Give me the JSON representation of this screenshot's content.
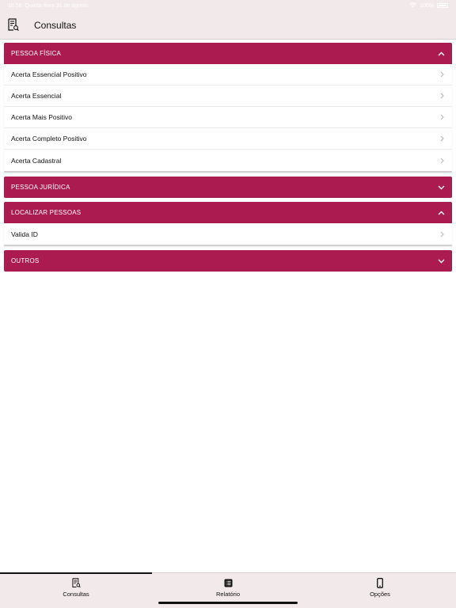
{
  "status_bar": {
    "time": "10:56",
    "date": "Quarta-feira 31 de agosto",
    "battery": "100%"
  },
  "header": {
    "title": "Consultas",
    "icon": "document-search-icon"
  },
  "sections": [
    {
      "label": "PESSOA FÍSICA",
      "expanded": true,
      "items": [
        {
          "label": "Acerta Essencial Positivo"
        },
        {
          "label": "Acerta Essencial"
        },
        {
          "label": "Acerta Mais Positivo"
        },
        {
          "label": "Acerta Completo Positivo"
        },
        {
          "label": "Acerta Cadastral"
        }
      ]
    },
    {
      "label": "PESSOA JURÍDICA",
      "expanded": false,
      "items": []
    },
    {
      "label": "LOCALIZAR PESSOAS",
      "expanded": true,
      "items": [
        {
          "label": "Valida ID"
        }
      ]
    },
    {
      "label": "OUTROS",
      "expanded": false,
      "items": []
    }
  ],
  "tabbar": {
    "tabs": [
      {
        "label": "Consultas",
        "icon": "document-search-icon",
        "active": true
      },
      {
        "label": "Relatório",
        "icon": "report-list-icon",
        "active": false
      },
      {
        "label": "Opções",
        "icon": "phone-icon",
        "active": false
      }
    ]
  },
  "colors": {
    "accent": "#ab1b4f",
    "bar_background": "#f2e9ea"
  }
}
